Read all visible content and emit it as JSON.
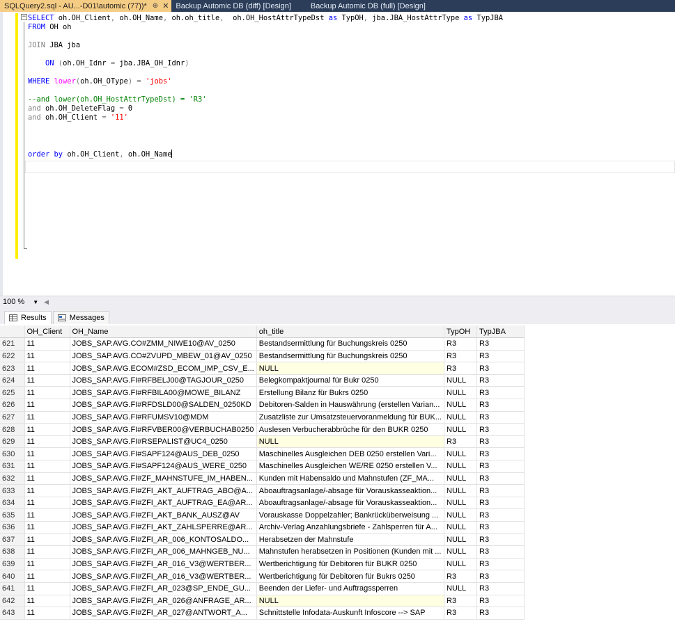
{
  "tabs": [
    {
      "label": "SQLQuery2.sql - AU...-D01\\automic (77))*",
      "active": true,
      "pin": "⊕",
      "close": "✕"
    },
    {
      "label": "Backup Automic DB (diff) [Design]",
      "active": false
    },
    {
      "label": "Backup Automic DB (full) [Design]",
      "active": false
    }
  ],
  "editor": {
    "fold_symbol": "−",
    "lines": [
      [
        {
          "t": "SELECT ",
          "c": "kw"
        },
        {
          "t": "oh.OH_Client",
          "c": "id"
        },
        {
          "t": ", ",
          "c": "op"
        },
        {
          "t": "oh.OH_Name",
          "c": "id"
        },
        {
          "t": ", ",
          "c": "op"
        },
        {
          "t": "oh.oh_title",
          "c": "id"
        },
        {
          "t": ",  ",
          "c": "op"
        },
        {
          "t": "oh.OH_HostAttrTypeDst ",
          "c": "id"
        },
        {
          "t": "as ",
          "c": "kw"
        },
        {
          "t": "TypOH",
          "c": "id"
        },
        {
          "t": ", ",
          "c": "op"
        },
        {
          "t": "jba.JBA_HostAttrType ",
          "c": "id"
        },
        {
          "t": "as ",
          "c": "kw"
        },
        {
          "t": "TypJBA",
          "c": "id"
        }
      ],
      [
        {
          "t": "FROM ",
          "c": "kw"
        },
        {
          "t": "OH oh",
          "c": "id"
        }
      ],
      [],
      [
        {
          "t": "JOIN ",
          "c": "op"
        },
        {
          "t": "JBA jba",
          "c": "id"
        }
      ],
      [],
      [
        {
          "t": "    ON ",
          "c": "kw"
        },
        {
          "t": "(",
          "c": "op"
        },
        {
          "t": "oh.OH_Idnr ",
          "c": "id"
        },
        {
          "t": "= ",
          "c": "op"
        },
        {
          "t": "jba.JBA_OH_Idnr",
          "c": "id"
        },
        {
          "t": ")",
          "c": "op"
        }
      ],
      [],
      [
        {
          "t": "WHERE ",
          "c": "kw"
        },
        {
          "t": "lower",
          "c": "fn"
        },
        {
          "t": "(",
          "c": "op"
        },
        {
          "t": "oh.OH_OType",
          "c": "id"
        },
        {
          "t": ") = ",
          "c": "op"
        },
        {
          "t": "'jobs'",
          "c": "str"
        }
      ],
      [],
      [
        {
          "t": "--and lower(oh.OH_HostAttrTypeDst) = 'R3'",
          "c": "cm"
        }
      ],
      [
        {
          "t": "and ",
          "c": "op"
        },
        {
          "t": "oh.OH_DeleteFlag ",
          "c": "id"
        },
        {
          "t": "= ",
          "c": "op"
        },
        {
          "t": "0",
          "c": "id"
        }
      ],
      [
        {
          "t": "and ",
          "c": "op"
        },
        {
          "t": "oh.OH_Client ",
          "c": "id"
        },
        {
          "t": "= ",
          "c": "op"
        },
        {
          "t": "'11'",
          "c": "str"
        }
      ],
      [],
      [],
      [],
      [
        {
          "t": "order by ",
          "c": "kw"
        },
        {
          "t": "oh.OH_Client",
          "c": "id"
        },
        {
          "t": ", ",
          "c": "op"
        },
        {
          "t": "oh.OH_Name",
          "c": "id"
        }
      ]
    ]
  },
  "zoom": {
    "value": "100 %",
    "arrow": "▼",
    "scroll_left": "◀"
  },
  "result_tabs": [
    {
      "label": "Results",
      "active": true,
      "icon": "grid-icon"
    },
    {
      "label": "Messages",
      "active": false,
      "icon": "messages-icon"
    }
  ],
  "grid": {
    "columns": [
      "",
      "OH_Client",
      "OH_Name",
      "oh_title",
      "TypOH",
      "TypJBA"
    ],
    "rows": [
      [
        "621",
        "11",
        "JOBS_SAP.AVG.CO#ZMM_NIWE10@AV_0250",
        "Bestandsermittlung für Buchungskreis 0250",
        "R3",
        "R3"
      ],
      [
        "622",
        "11",
        "JOBS_SAP.AVG.CO#ZVUPD_MBEW_01@AV_0250",
        "Bestandsermittlung für Buchungskreis 0250",
        "R3",
        "R3"
      ],
      [
        "623",
        "11",
        "JOBS_SAP.AVG.ECOM#ZSD_ECOM_IMP_CSV_E...",
        "NULL",
        "R3",
        "R3"
      ],
      [
        "624",
        "11",
        "JOBS_SAP.AVG.FI#RFBELJ00@TAGJOUR_0250",
        "Belegkompaktjournal für Bukr 0250",
        "NULL",
        "R3"
      ],
      [
        "625",
        "11",
        "JOBS_SAP.AVG.FI#RFBILA00@MOWE_BILANZ",
        "Erstellung Bilanz für Bukrs 0250",
        "NULL",
        "R3"
      ],
      [
        "626",
        "11",
        "JOBS_SAP.AVG.FI#RFDSLD00@SALDEN_0250KD",
        "Debitoren-Salden in Hauswährung (erstellen Varian...",
        "NULL",
        "R3"
      ],
      [
        "627",
        "11",
        "JOBS_SAP.AVG.FI#RFUMSV10@MDM",
        "Zusatzliste zur Umsatzsteuervoranmeldung für BUK...",
        "NULL",
        "R3"
      ],
      [
        "628",
        "11",
        "JOBS_SAP.AVG.FI#RFVBER00@VERBUCHAB0250",
        "Auslesen Verbucherabbrüche für den BUKR 0250",
        "NULL",
        "R3"
      ],
      [
        "629",
        "11",
        "JOBS_SAP.AVG.FI#RSEPALIST@UC4_0250",
        "NULL",
        "R3",
        "R3"
      ],
      [
        "630",
        "11",
        "JOBS_SAP.AVG.FI#SAPF124@AUS_DEB_0250",
        "Maschinelles Ausgleichen DEB 0250 erstellen Vari...",
        "NULL",
        "R3"
      ],
      [
        "631",
        "11",
        "JOBS_SAP.AVG.FI#SAPF124@AUS_WERE_0250",
        "Maschinelles Ausgleichen WE/RE 0250 erstellen V...",
        "NULL",
        "R3"
      ],
      [
        "632",
        "11",
        "JOBS_SAP.AVG.FI#ZF_MAHNSTUFE_IM_HABEN...",
        "Kunden mit Habensaldo und Mahnstufen  (ZF_MA...",
        "NULL",
        "R3"
      ],
      [
        "633",
        "11",
        "JOBS_SAP.AVG.FI#ZFI_AKT_AUFTRAG_ABO@A...",
        "Aboauftragsanlage/-absage für Vorauskasseaktion...",
        "NULL",
        "R3"
      ],
      [
        "634",
        "11",
        "JOBS_SAP.AVG.FI#ZFI_AKT_AUFTRAG_EA@AR...",
        "Aboauftragsanlage/-absage für Vorauskasseaktion...",
        "NULL",
        "R3"
      ],
      [
        "635",
        "11",
        "JOBS_SAP.AVG.FI#ZFI_AKT_BANK_AUSZ@AV",
        "Vorauskasse Doppelzahler; Bankrücküberweisung ...",
        "NULL",
        "R3"
      ],
      [
        "636",
        "11",
        "JOBS_SAP.AVG.FI#ZFI_AKT_ZAHLSPERRE@AR...",
        "Archiv-Verlag Anzahlungsbriefe - Zahlsperren für A...",
        "NULL",
        "R3"
      ],
      [
        "637",
        "11",
        "JOBS_SAP.AVG.FI#ZFI_AR_006_KONTOSALDO...",
        "Herabsetzen der Mahnstufe",
        "NULL",
        "R3"
      ],
      [
        "638",
        "11",
        "JOBS_SAP.AVG.FI#ZFI_AR_006_MAHNGEB_NU...",
        "Mahnstufen herabsetzen in Positionen (Kunden mit ...",
        "NULL",
        "R3"
      ],
      [
        "639",
        "11",
        "JOBS_SAP.AVG.FI#ZFI_AR_016_V3@WERTBER...",
        "Wertberichtigung für Debitoren für BUKR 0250",
        "NULL",
        "R3"
      ],
      [
        "640",
        "11",
        "JOBS_SAP.AVG.FI#ZFI_AR_016_V3@WERTBER...",
        "Wertberichtigung für Debitoren für Bukrs 0250",
        "R3",
        "R3"
      ],
      [
        "641",
        "11",
        "JOBS_SAP.AVG.FI#ZFI_AR_023@SP_ENDE_GU...",
        "Beenden der Liefer- und Auftragssperren",
        "NULL",
        "R3"
      ],
      [
        "642",
        "11",
        "JOBS_SAP.AVG.FI#ZFI_AR_026@ANFRAGE_AR...",
        "NULL",
        "R3",
        "R3"
      ],
      [
        "643",
        "11",
        "JOBS_SAP.AVG.FI#ZFI_AR_027@ANTWORT_A...",
        "Schnittstelle Infodata-Auskunft  Infoscore --> SAP",
        "R3",
        "R3"
      ]
    ]
  },
  "colors": {
    "tab_bar": "#2b3d59",
    "active_tab": "#f5cc84",
    "change_bar": "#ffee00",
    "null_cell": "#ffffe1"
  }
}
